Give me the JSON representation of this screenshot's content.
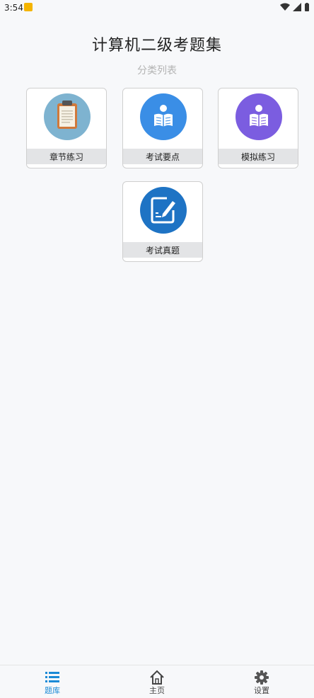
{
  "status_bar": {
    "time": "3:54"
  },
  "header": {
    "title": "计算机二级考题集",
    "subtitle": "分类列表"
  },
  "categories": [
    {
      "label": "章节练习",
      "icon": "clipboard-icon",
      "color": "#7eb3d0"
    },
    {
      "label": "考试要点",
      "icon": "reading-person-icon",
      "color": "#3a8ee6"
    },
    {
      "label": "模拟练习",
      "icon": "reading-person-icon",
      "color": "#7b5de0"
    },
    {
      "label": "考试真题",
      "icon": "edit-document-icon",
      "color": "#1e73c4"
    }
  ],
  "tab_bar": {
    "active_color": "#1a8ad6",
    "inactive_color": "#444444",
    "items": [
      {
        "label": "题库",
        "icon": "list-icon",
        "active": true
      },
      {
        "label": "主页",
        "icon": "home-icon",
        "active": false
      },
      {
        "label": "设置",
        "icon": "gear-icon",
        "active": false
      }
    ]
  }
}
